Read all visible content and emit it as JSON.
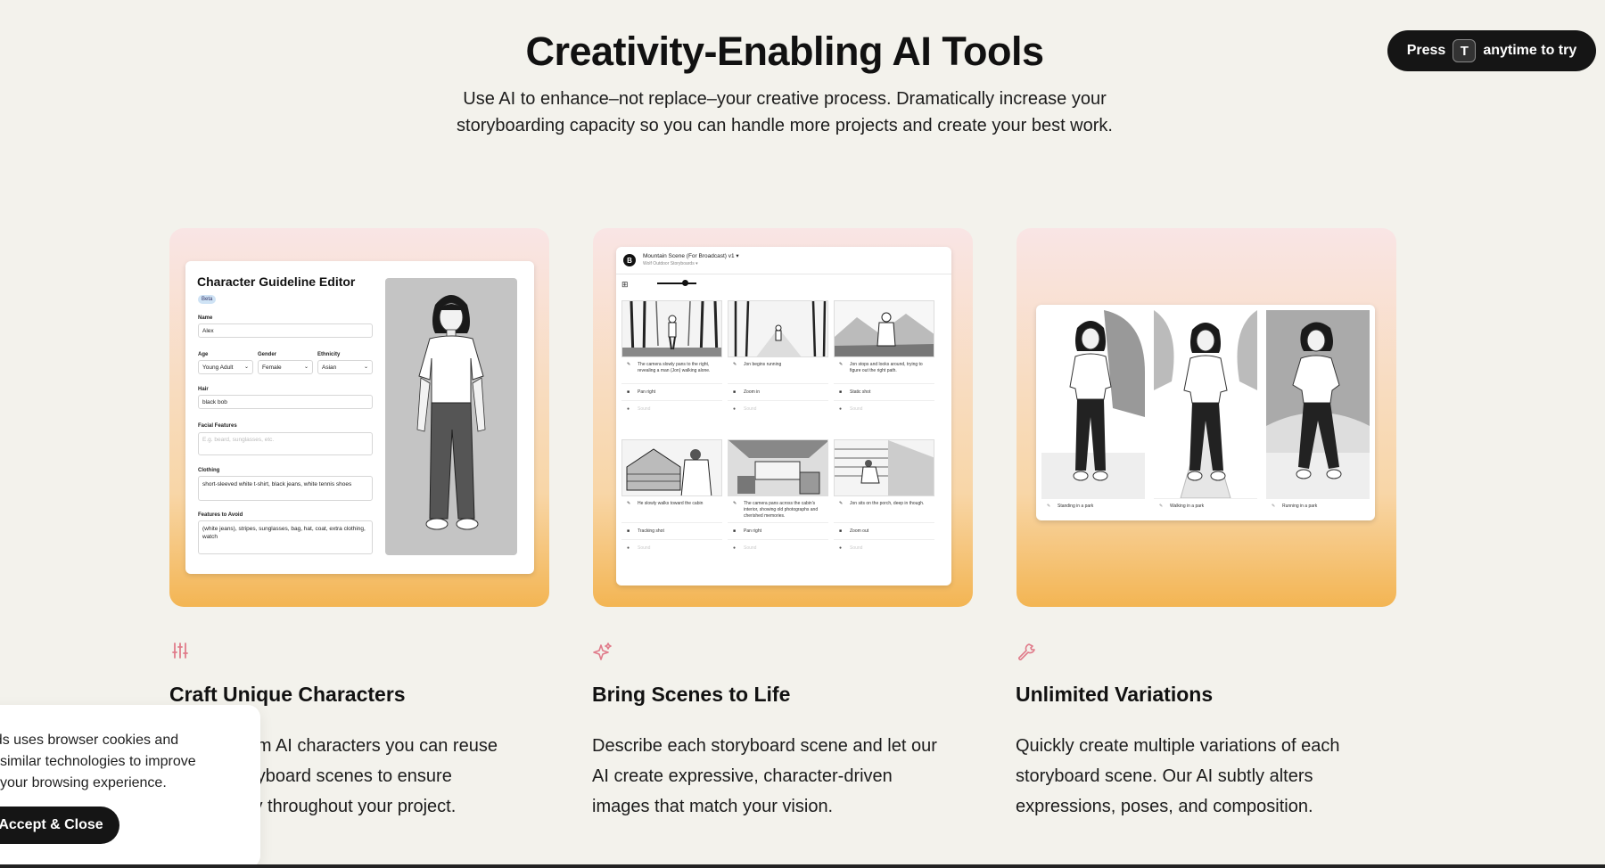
{
  "header": {
    "title": "Creativity-Enabling AI Tools",
    "subtitle": "Use AI to enhance–not replace–your creative process. Dramatically increase your storyboarding capacity so you can handle more projects and create your best work."
  },
  "try_pill": {
    "prefix": "Press",
    "key": "T",
    "suffix": "anytime to try"
  },
  "editor": {
    "title": "Character Guideline Editor",
    "badge": "Beta",
    "name_label": "Name",
    "name_value": "Alex",
    "age_label": "Age",
    "age_value": "Young Adult",
    "gender_label": "Gender",
    "gender_value": "Female",
    "ethnicity_label": "Ethnicity",
    "ethnicity_value": "Asian",
    "hair_label": "Hair",
    "hair_value": "black bob",
    "facial_label": "Facial Features",
    "facial_placeholder": "E.g. beard, sunglasses, etc.",
    "clothing_label": "Clothing",
    "clothing_value": "short-sleeved white t-shirt, black jeans, white tennis shoes",
    "avoid_label": "Features to Avoid",
    "avoid_value": "(white jeans), stripes, sunglasses, bag, hat, coat, extra clothing, watch"
  },
  "storyboard": {
    "logo": "B",
    "title": "Mountain Scene (For Broadcast)  v1 ▾",
    "folder": "Wolf Outdoor Storyboards ▾",
    "panels": [
      {
        "text": "The camera slowly pans to the right, revealing a man (Jon) walking alone.",
        "shot": "Pan right",
        "sound": "Sound"
      },
      {
        "text": "Jon begins running",
        "shot": "Zoom in",
        "sound": "Sound"
      },
      {
        "text": "Jon stops and looks around, trying to figure out the right path.",
        "shot": "Static shot",
        "sound": "Sound"
      },
      {
        "text": "He slowly walks toward the cabin",
        "shot": "Tracking shot",
        "sound": "Sound"
      },
      {
        "text": "The camera pans across the cabin's interior, showing old photographs and cherished memories.",
        "shot": "Pan right",
        "sound": "Sound"
      },
      {
        "text": "Jon sits on the porch, deep in though.",
        "shot": "Zoom out",
        "sound": "Sound"
      }
    ]
  },
  "variations": {
    "captions": [
      "Standing in a park",
      "Walking in a park",
      "Running in a park"
    ]
  },
  "features": [
    {
      "icon": "sliders-icon",
      "title": "Craft Unique Characters",
      "desc": "Build custom AI characters you can reuse across storyboard scenes to ensure consistency throughout your project."
    },
    {
      "icon": "sparkles-icon",
      "title": "Bring Scenes to Life",
      "desc": "Describe each storyboard scene and let our AI create expressive, character-driven images that match your vision."
    },
    {
      "icon": "wrench-icon",
      "title": "Unlimited Variations",
      "desc": "Quickly create multiple variations of each storyboard scene. Our AI subtly alters expressions, poses, and composition."
    }
  ],
  "cookie": {
    "text": "Boords uses browser cookies and similar technologies to improve your browsing experience.",
    "button": "Accept & Close"
  },
  "colors": {
    "accent": "#e07b8a",
    "card_bottom": "#f3b553",
    "background": "#f3f2ec"
  }
}
